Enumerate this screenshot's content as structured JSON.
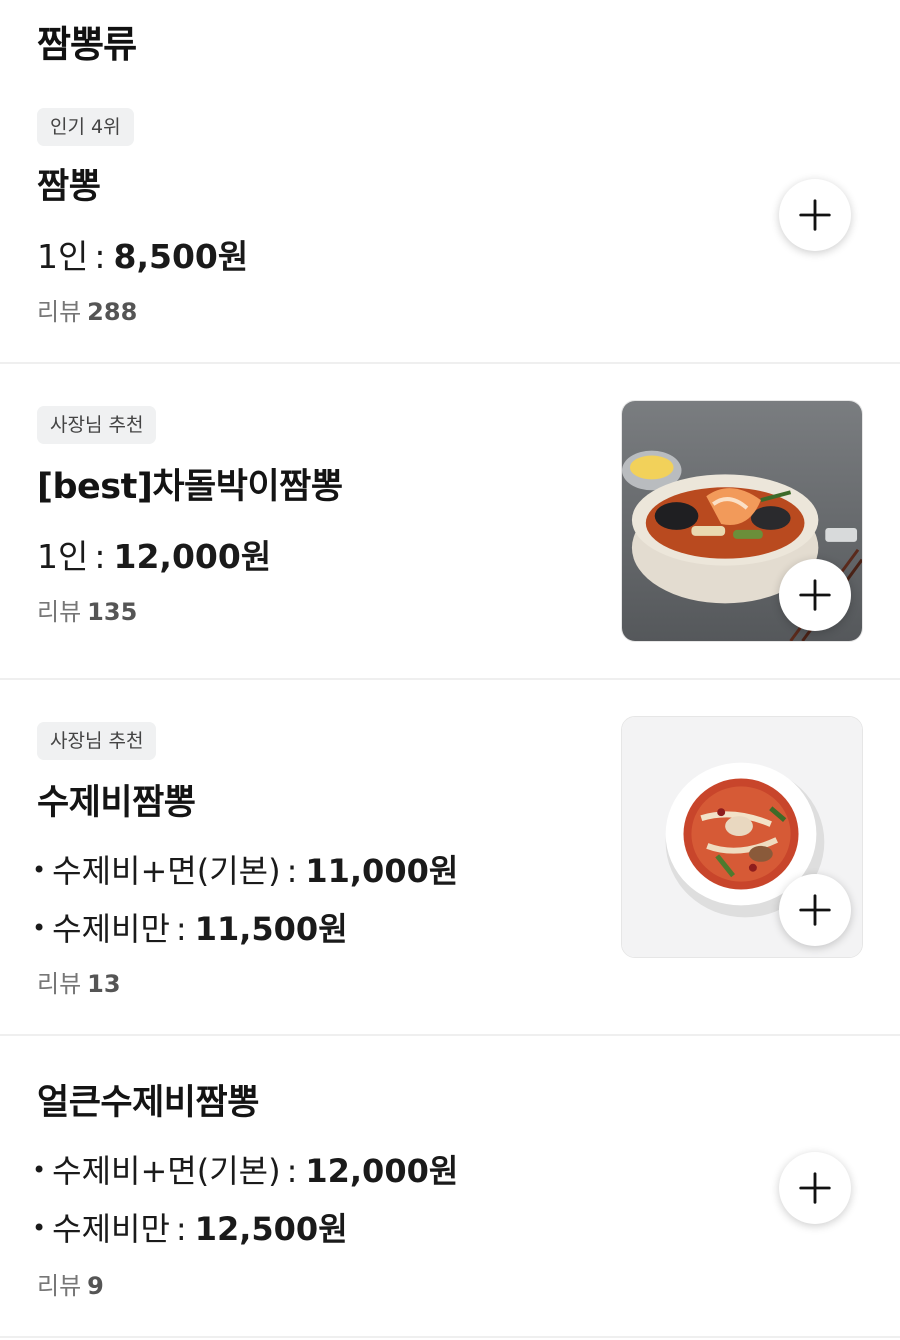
{
  "section": {
    "title": "짬뽕류"
  },
  "items": [
    {
      "badge": "인기 4위",
      "name": "짬뽕",
      "price": {
        "label": "1인",
        "amount": "8,500원"
      },
      "review": {
        "label": "리뷰",
        "count": "288"
      },
      "add_icon": "plus-icon"
    },
    {
      "badge": "사장님 추천",
      "name": "[best]차돌박이짬뽕",
      "price": {
        "label": "1인",
        "amount": "12,000원"
      },
      "review": {
        "label": "리뷰",
        "count": "135"
      },
      "image": "seafood-jjambbong-bowl-photo",
      "add_icon": "plus-icon"
    },
    {
      "badge": "사장님 추천",
      "name": "수제비짬뽕",
      "options": [
        {
          "label": "수제비+면(기본)",
          "amount": "11,000원"
        },
        {
          "label": "수제비만",
          "amount": "11,500원"
        }
      ],
      "review": {
        "label": "리뷰",
        "count": "13"
      },
      "image": "sujebi-jjambbong-bowl-photo",
      "add_icon": "plus-icon"
    },
    {
      "name": "얼큰수제비짬뽕",
      "options": [
        {
          "label": "수제비+면(기본)",
          "amount": "12,000원"
        },
        {
          "label": "수제비만",
          "amount": "12,500원"
        }
      ],
      "review": {
        "label": "리뷰",
        "count": "9"
      },
      "add_icon": "plus-icon"
    }
  ],
  "price_separator": ":",
  "bullet": "•"
}
